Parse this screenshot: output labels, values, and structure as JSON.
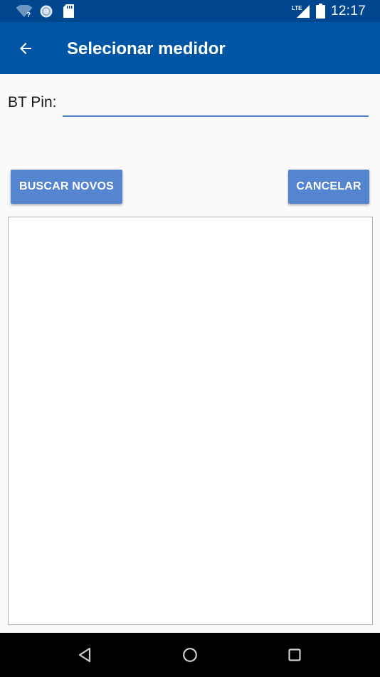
{
  "status_bar": {
    "time": "12:17",
    "network_label": "LTE",
    "icons": [
      "wifi-question-icon",
      "sync-circle-icon",
      "sd-card-icon",
      "lte-signal-icon",
      "battery-icon"
    ]
  },
  "app_bar": {
    "title": "Selecionar medidor",
    "back_icon": "arrow-back-icon"
  },
  "form": {
    "pin_label": "BT Pin:",
    "pin_value": "",
    "pin_placeholder": ""
  },
  "buttons": {
    "search_label": "BUSCAR NOVOS",
    "cancel_label": "CANCELAR"
  },
  "meter_list": {
    "items": []
  },
  "nav_bar": {
    "icons": [
      "back-triangle-icon",
      "home-circle-icon",
      "recents-square-icon"
    ]
  },
  "colors": {
    "status_bar": "#00478f",
    "app_bar": "#0055a4",
    "button": "#5585d0",
    "input_underline": "#4a7ec7"
  }
}
